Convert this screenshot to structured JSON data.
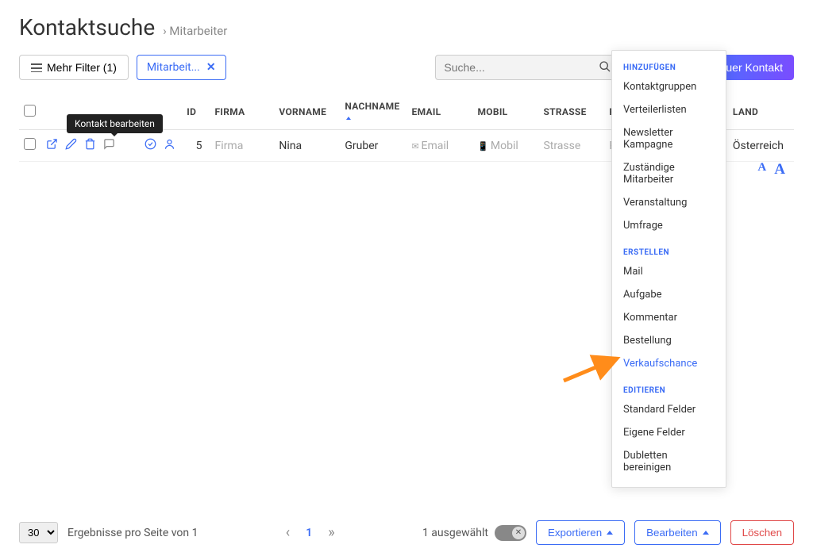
{
  "page_title": "Kontaktsuche",
  "breadcrumb": "Mitarbeiter",
  "toolbar": {
    "more_filter": "Mehr Filter (1)",
    "chip_label": "Mitarbeit...",
    "search_placeholder": "Suche...",
    "new_contact": "uer Kontakt"
  },
  "tooltip_edit": "Kontakt bearbeiten",
  "columns": {
    "id": "ID",
    "firma": "FIRMA",
    "vorname": "VORNAME",
    "nachname": "NACHNAME",
    "email": "EMAIL",
    "mobil": "MOBIL",
    "strasse": "STRASSE",
    "plz": "P",
    "land": "LAND"
  },
  "row": {
    "id": "5",
    "firma": "Firma",
    "vorname": "Nina",
    "nachname": "Gruber",
    "email": "Email",
    "mobil": "Mobil",
    "strasse": "Strasse",
    "plz": "Pl",
    "land": "Österreich"
  },
  "dropdown": {
    "sec_add": "HINZUFÜGEN",
    "add_items": [
      "Kontaktgruppen",
      "Verteilerlisten",
      "Newsletter Kampagne",
      "Zuständige Mitarbeiter",
      "Veranstaltung",
      "Umfrage"
    ],
    "sec_create": "ERSTELLEN",
    "create_items": [
      "Mail",
      "Aufgabe",
      "Kommentar",
      "Bestellung",
      "Verkaufschance"
    ],
    "sec_edit": "EDITIEREN",
    "edit_items": [
      "Standard Felder",
      "Eigene Felder",
      "Dubletten bereinigen"
    ]
  },
  "footer": {
    "page_size": "30",
    "results_label": "Ergebnisse pro Seite von 1",
    "current_page": "1",
    "selected_label": "1 ausgewählt",
    "export": "Exportieren",
    "edit": "Bearbeiten",
    "delete": "Löschen"
  }
}
